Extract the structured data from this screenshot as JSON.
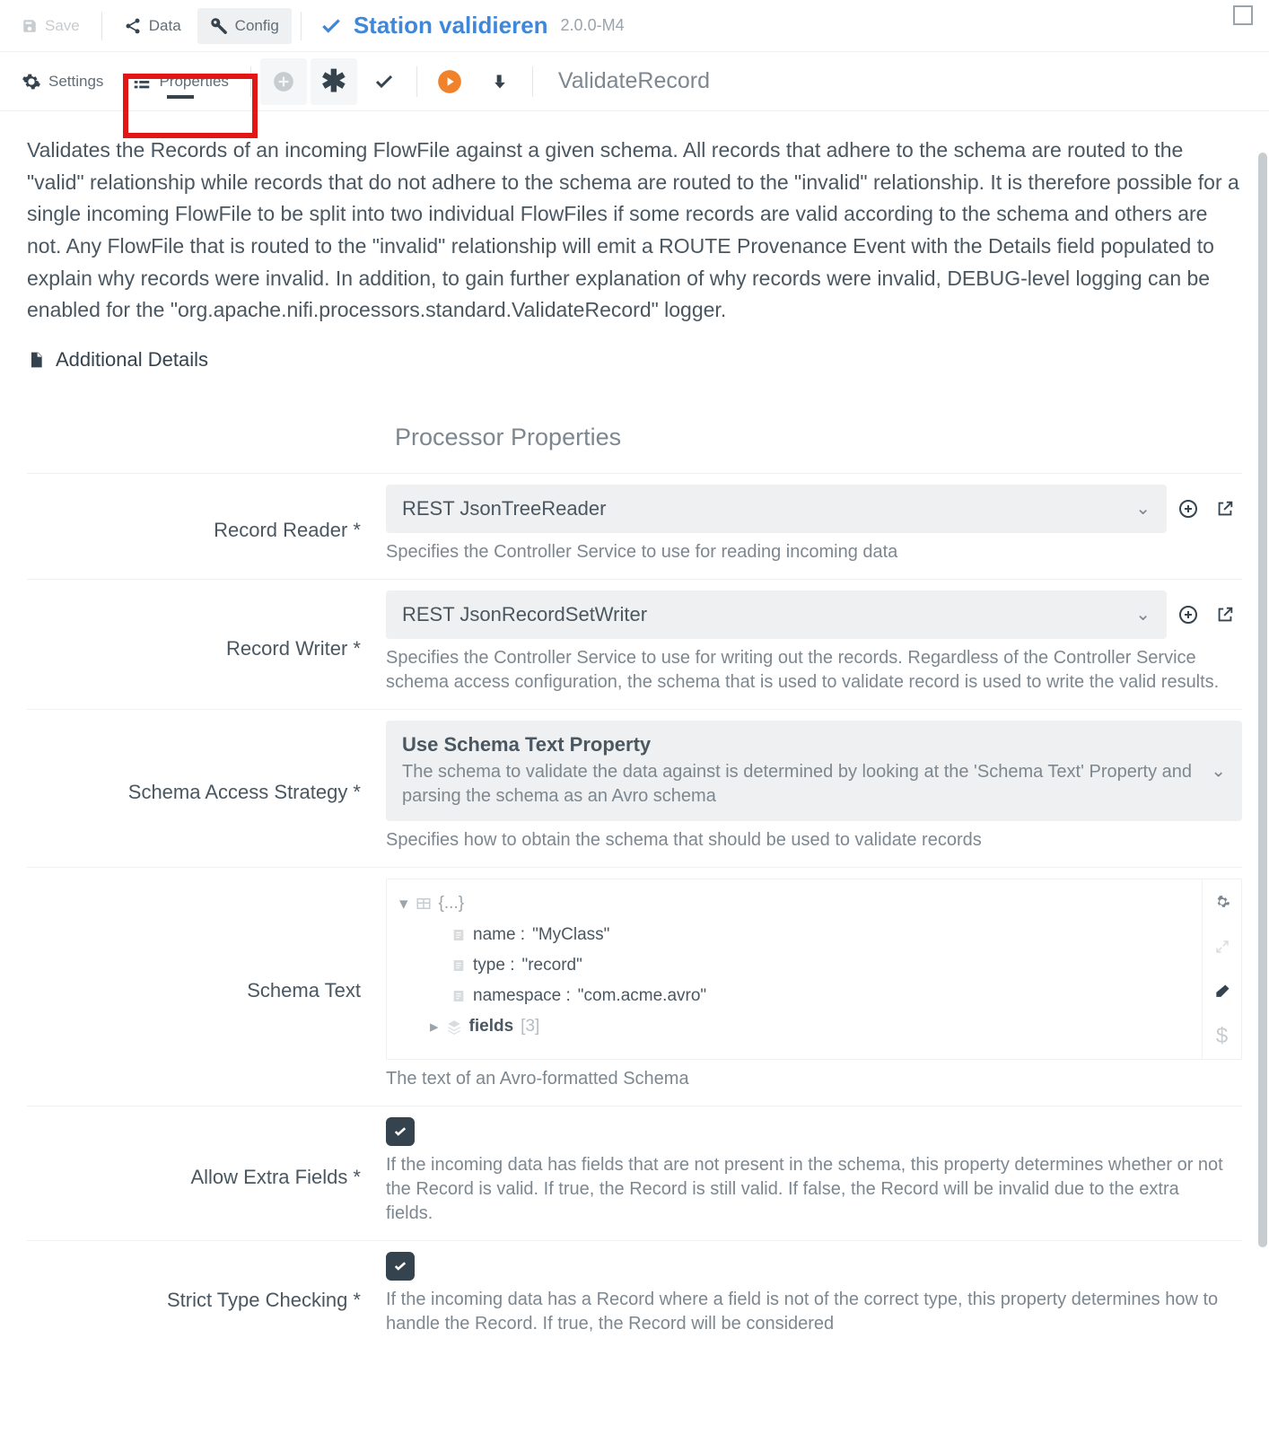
{
  "topbar": {
    "save": "Save",
    "data": "Data",
    "config": "Config",
    "title": "Station validieren",
    "version": "2.0.0-M4"
  },
  "secondbar": {
    "settings": "Settings",
    "properties": "Properties",
    "processor_name": "ValidateRecord"
  },
  "description": "Validates the Records of an incoming FlowFile against a given schema. All records that adhere to the schema are routed to the \"valid\" relationship while records that do not adhere to the schema are routed to the \"invalid\" relationship. It is therefore possible for a single incoming FlowFile to be split into two individual FlowFiles if some records are valid according to the schema and others are not. Any FlowFile that is routed to the \"invalid\" relationship will emit a ROUTE Provenance Event with the Details field populated to explain why records were invalid. In addition, to gain further explanation of why records were invalid, DEBUG-level logging can be enabled for the \"org.apache.nifi.processors.standard.ValidateRecord\" logger.",
  "additional_details": "Additional Details",
  "props_header": "Processor Properties",
  "props": {
    "record_reader": {
      "label": "Record Reader *",
      "value": "REST JsonTreeReader",
      "help": "Specifies the Controller Service to use for reading incoming data"
    },
    "record_writer": {
      "label": "Record Writer *",
      "value": "REST JsonRecordSetWriter",
      "help": "Specifies the Controller Service to use for writing out the records. Regardless of the Controller Service schema access configuration, the schema that is used to validate record is used to write the valid results."
    },
    "schema_strategy": {
      "label": "Schema Access Strategy *",
      "value": "Use Schema Text Property",
      "sub": "The schema to validate the data against is determined by looking at the 'Schema Text' Property and parsing the schema as an Avro schema",
      "help": "Specifies how to obtain the schema that should be used to validate records"
    },
    "schema_text": {
      "label": "Schema Text",
      "root": "{...}",
      "name_k": "name :",
      "name_v": "\"MyClass\"",
      "type_k": "type :",
      "type_v": "\"record\"",
      "ns_k": "namespace :",
      "ns_v": "\"com.acme.avro\"",
      "fields": "fields",
      "fields_count": "[3]",
      "help": "The text of an Avro-formatted Schema"
    },
    "allow_extra": {
      "label": "Allow Extra Fields *",
      "help": "If the incoming data has fields that are not present in the schema, this property determines whether or not the Record is valid. If true, the Record is still valid. If false, the Record will be invalid due to the extra fields."
    },
    "strict": {
      "label": "Strict Type Checking *",
      "help": "If the incoming data has a Record where a field is not of the correct type, this property determines how to handle the Record. If true, the Record will be considered"
    }
  }
}
